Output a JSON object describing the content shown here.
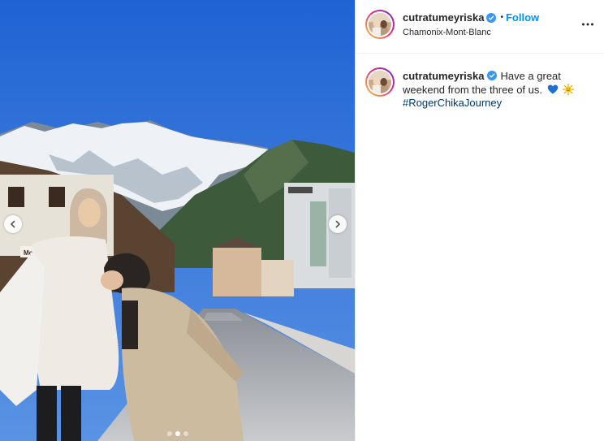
{
  "post": {
    "username": "cutratumeyriska",
    "follow_label": "Follow",
    "separator": "•",
    "location": "Chamonix-Mont-Blanc",
    "caption": {
      "text": "Have a great weekend from the three of us.",
      "emojis": [
        "blue-heart-icon",
        "sun-face-icon"
      ],
      "hashtag": "#RogerChikaJourney"
    },
    "media": {
      "slide_count": 3,
      "active_slide": 2,
      "shop_sign": "Mounta"
    }
  },
  "colors": {
    "accent": "#0095f6",
    "verified": "#3897f0",
    "hashtag": "#00376b",
    "sky": "#2f6fd6"
  },
  "icons": {
    "verified": "verified-badge-icon",
    "more": "more-options-icon",
    "prev": "chevron-left-icon",
    "next": "chevron-right-icon"
  }
}
